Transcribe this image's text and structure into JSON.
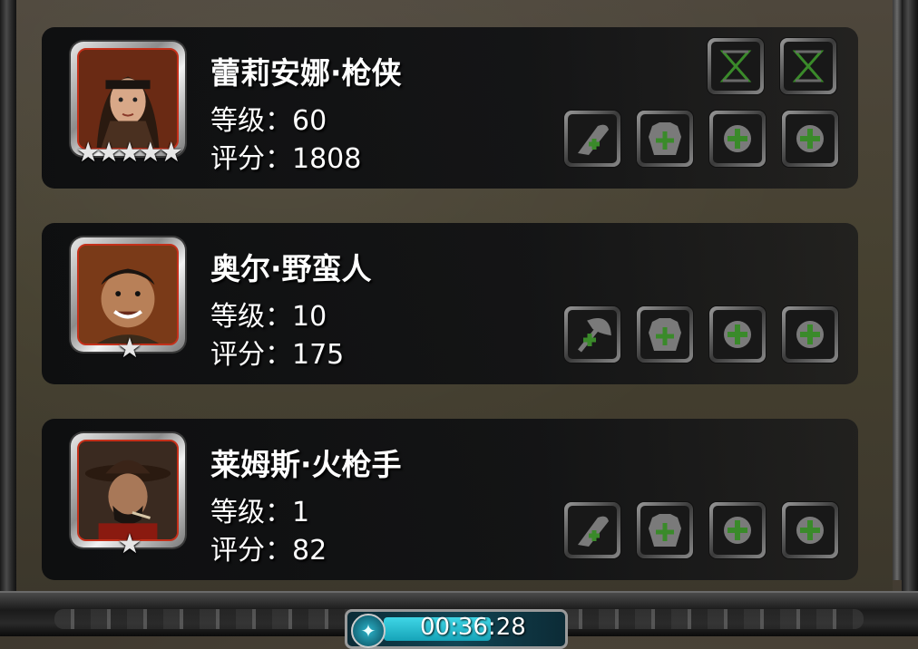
{
  "heroes": [
    {
      "name": "蕾莉安娜·枪侠",
      "level_text": "等级：60",
      "score_text": "评分：1808",
      "stars": "★★★★★",
      "portrait": "female-gunslinger-portrait",
      "extra_slots": [
        "hourglass-icon",
        "hourglass-icon"
      ],
      "slots": [
        "weapon-slot-icon",
        "armor-slot-icon",
        "ring-slot-icon",
        "ring-slot-icon"
      ]
    },
    {
      "name": "奥尔·野蛮人",
      "level_text": "等级：10",
      "score_text": "评分：175",
      "stars": "★",
      "portrait": "barbarian-portrait",
      "extra_slots": [],
      "slots": [
        "axe-slot-icon",
        "armor-slot-icon",
        "ring-slot-icon",
        "ring-slot-icon"
      ]
    },
    {
      "name": "莱姆斯·火枪手",
      "level_text": "等级：1",
      "score_text": "评分：82",
      "stars": "★",
      "portrait": "musketeer-portrait",
      "extra_slots": [],
      "slots": [
        "weapon-slot-icon",
        "armor-slot-icon",
        "ring-slot-icon",
        "ring-slot-icon"
      ]
    }
  ],
  "timer": {
    "text": "00:36:28",
    "progress": 0.5
  },
  "colors": {
    "slot_accent": "#3a8a2a",
    "portrait_border": "#c4301a",
    "timer_fill": "#3fd6e6"
  }
}
